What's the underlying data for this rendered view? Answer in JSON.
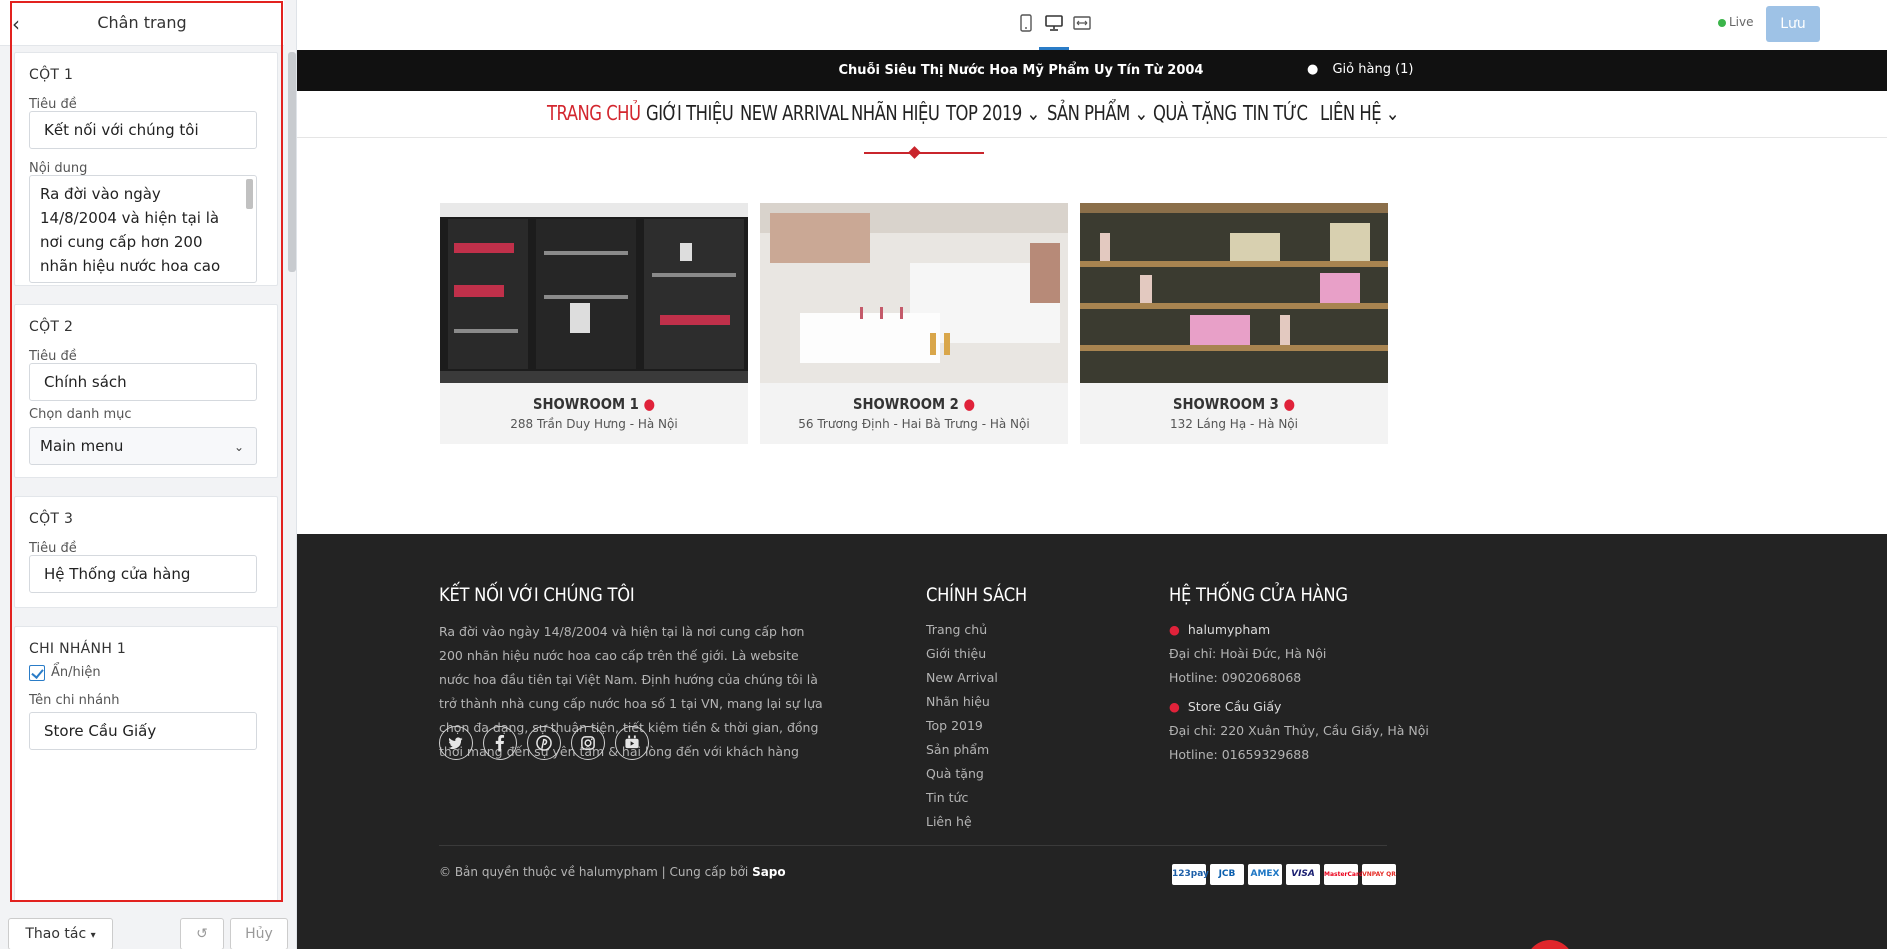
{
  "editor": {
    "title": "Chân trang",
    "col1": {
      "title": "CỘT 1",
      "label_title": "Tiêu đề",
      "title_value": "Kết nối với chúng tôi",
      "label_content": "Nội dung",
      "content_value": "Ra đời vào ngày 14/8/2004 và hiện tại là nơi cung cấp hơn 200 nhãn hiệu nước hoa cao cấp trên thế giới."
    },
    "col2": {
      "title": "CỘT 2",
      "label_title": "Tiêu đề",
      "title_value": "Chính sách",
      "label_menu": "Chọn danh mục",
      "menu_value": "Main menu"
    },
    "col3": {
      "title": "CỘT 3",
      "label_title": "Tiêu đề",
      "title_value": "Hệ Thống cửa hàng"
    },
    "branch1": {
      "title": "CHI NHÁNH 1",
      "show_label": "Ẩn/hiện",
      "name_label": "Tên chi nhánh",
      "name_value": "Store Cầu Giấy"
    },
    "actions_label": "Thao tác",
    "cancel_label": "Hủy"
  },
  "topbar": {
    "live_label": "Live",
    "save_label": "Lưu",
    "accent_color": "#2a7cc7"
  },
  "site": {
    "slogan": "Chuỗi Siêu Thị Nước Hoa Mỹ Phẩm Uy Tín Từ 2004",
    "cart": "Giỏ hàng (1)",
    "nav": [
      "TRANG CHỦ",
      "GIỚI THIỆU",
      "NEW ARRIVAL",
      "NHÃN HIỆU",
      "TOP 2019",
      "SẢN PHẨM",
      "QUÀ TẶNG",
      "TIN TỨC",
      "LIÊN HỆ"
    ],
    "showrooms": [
      {
        "name": "SHOWROOM 1",
        "address": "288 Trần Duy Hưng - Hà Nội"
      },
      {
        "name": "SHOWROOM 2",
        "address": "56 Trương Định - Hai Bà Trưng - Hà Nội"
      },
      {
        "name": "SHOWROOM 3",
        "address": "132 Láng Hạ - Hà Nội"
      }
    ],
    "footer": {
      "col1_heading": "KẾT NỐI VỚI CHÚNG TÔI",
      "about": "Ra đời vào ngày 14/8/2004 và hiện tại là nơi cung cấp hơn 200 nhãn hiệu nước hoa cao cấp trên thế giới. Là website nước hoa đầu tiên tại Việt Nam. Định hướng của chúng tôi là trở thành nhà cung cấp nước hoa số 1 tại VN, mang lại sự lựa chọn đa dạng, sự thuận tiện, tiết kiệm tiền & thời gian, đồng thời mang đến sự yên tâm & hài lòng đến với khách hàng",
      "col2_heading": "CHÍNH SÁCH",
      "policy_links": [
        "Trang chủ",
        "Giới thiệu",
        "New Arrival",
        "Nhãn hiệu",
        "Top 2019",
        "Sản phẩm",
        "Quà tặng",
        "Tin tức",
        "Liên hệ"
      ],
      "col3_heading": "HỆ THỐNG CỬA HÀNG",
      "stores": [
        {
          "name": "halumypham",
          "address": "Đại chỉ: Hoài Đức, Hà Nội",
          "hotline": "Hotline: 0902068068"
        },
        {
          "name": "Store Cầu Giấy",
          "address": "Đại chỉ: 220 Xuân Thủy, Cầu Giấy, Hà Nội",
          "hotline": "Hotline: 01659329688"
        }
      ],
      "copyright_prefix": "© Bản quyền thuộc về halumypham | Cung cấp bởi ",
      "copyright_brand": "Sapo",
      "payments": [
        "123pay",
        "JCB",
        "AMEX",
        "VISA",
        "MasterCard",
        "VNPAY QR"
      ]
    },
    "brand_red": "#d3262e",
    "footer_bg": "#232323"
  }
}
